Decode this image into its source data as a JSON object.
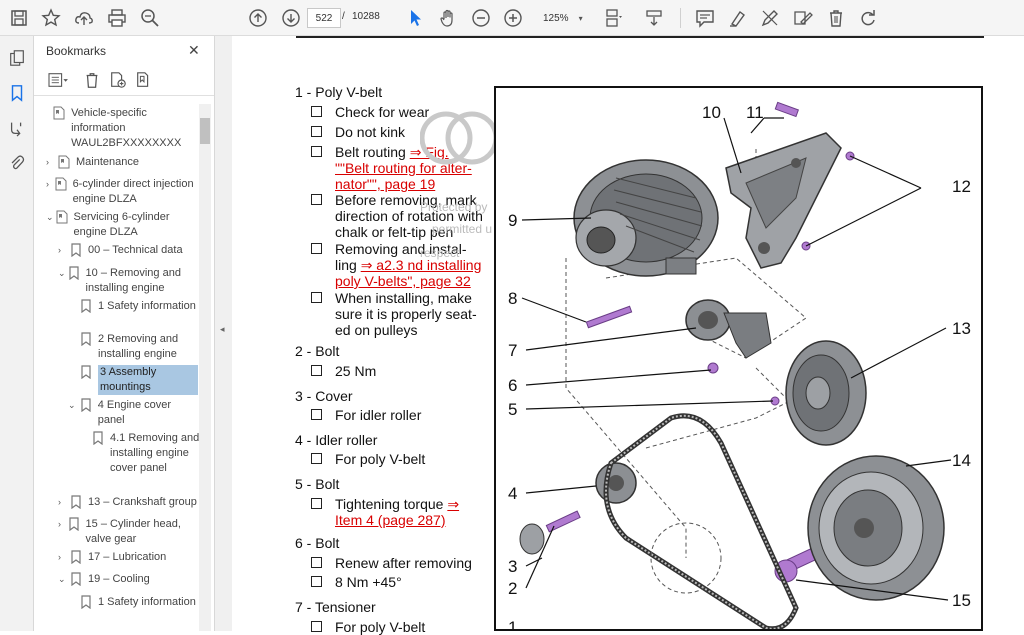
{
  "toolbar": {
    "page_current": "522",
    "page_separator": "/",
    "page_total": "10288",
    "zoom": "125%"
  },
  "panel": {
    "title": "Bookmarks",
    "close": "✕"
  },
  "tree": [
    {
      "label": "Vehicle-specific information WAUL2BFXXXXXXXX",
      "arrow": ""
    },
    {
      "label": "Maintenance",
      "arrow": "›"
    },
    {
      "label": "6-cylinder direct injection engine DLZA",
      "arrow": "›"
    },
    {
      "label": "Servicing 6-cylinder engine DLZA",
      "arrow": "⌄"
    },
    {
      "label": "00 – Technical data",
      "arrow": "›"
    },
    {
      "label": "10 – Removing and installing engine",
      "arrow": "⌄"
    },
    {
      "label": "1 Safety information",
      "arrow": ""
    },
    {
      "label": "2 Removing and installing engine",
      "arrow": ""
    },
    {
      "label": "3 Assembly mountings",
      "arrow": ""
    },
    {
      "label": "4 Engine cover panel",
      "arrow": "⌄"
    },
    {
      "label": "4.1 Removing and installing engine cover panel",
      "arrow": ""
    },
    {
      "label": "13 – Crankshaft group",
      "arrow": "›"
    },
    {
      "label": "15 – Cylinder head, valve gear",
      "arrow": "›"
    },
    {
      "label": "17 – Lubrication",
      "arrow": "›"
    },
    {
      "label": "19 – Cooling",
      "arrow": "⌄"
    },
    {
      "label": "1 Safety information",
      "arrow": ""
    }
  ],
  "doc": {
    "h1": "1 - Poly V-belt",
    "i1a": "Check for wear",
    "i1b": "Do not kink",
    "i1c_pre": "Belt routing ",
    "i1c_link1": "⇒ Fig.",
    "i1c_link2": "\"\"Belt routing for alter-",
    "i1c_link3": "nator\"\", page 19",
    "i1d_1": "Before removing, mark",
    "i1d_2": "direction of rotation with",
    "i1d_3": "chalk or felt-tip pen",
    "i1e_1": "Removing and instal-",
    "i1e_2_pre": "ling ",
    "i1e_2_link": "⇒ a2.3 nd installing",
    "i1e_3_link": "poly V-belts\", page 32",
    "i1f_1": "When installing, make",
    "i1f_2": "sure it is properly seat-",
    "i1f_3": "ed on pulleys",
    "h2": "2 - Bolt",
    "i2a": "25 Nm",
    "h3": "3 - Cover",
    "i3a": "For idler roller",
    "h4": "4 - Idler roller",
    "i4a": "For poly V-belt",
    "h5": "5 - Bolt",
    "i5a_pre": "Tightening torque ",
    "i5a_link1": "⇒",
    "i5a_link2": "Item 4 (page 287)",
    "h6": "6 - Bolt",
    "i6a": "Renew after removing",
    "i6b": "8 Nm +45°",
    "h7": "7 - Tensioner",
    "i7a": "For poly V-belt"
  },
  "figure": {
    "callouts": [
      "1",
      "2",
      "3",
      "4",
      "5",
      "6",
      "7",
      "8",
      "9",
      "10",
      "11",
      "12",
      "13",
      "14",
      "15"
    ]
  },
  "watermark": {
    "line1": "Protected by",
    "line2": "permitted u",
    "line3": "respect"
  },
  "colors": {
    "link": "#d80000",
    "selection": "#a9c7e2",
    "accent": "#1a73e8",
    "bolt": "#b07ad0"
  }
}
